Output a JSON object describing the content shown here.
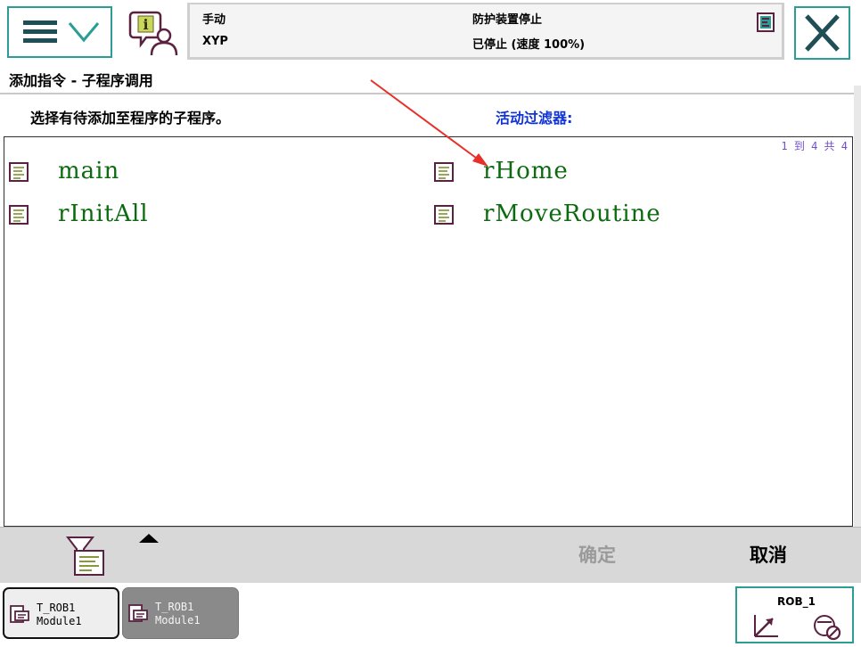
{
  "header": {
    "mode": "手动",
    "system_name": "XYP",
    "safety_state": "防护装置停止",
    "run_state": "已停止 (速度 100%)"
  },
  "page": {
    "title": "添加指令 - 子程序调用",
    "instruction": "选择有待添加至程序的子程序。",
    "filter_label": "活动过滤器:",
    "pager": "1 到 4 共 4"
  },
  "routines": [
    {
      "name": "main",
      "icon": "routine-icon"
    },
    {
      "name": "rHome",
      "icon": "routine-icon"
    },
    {
      "name": "rInitAll",
      "icon": "routine-icon"
    },
    {
      "name": "rMoveRoutine",
      "icon": "routine-icon"
    }
  ],
  "toolbar": {
    "ok_label": "确定",
    "cancel_label": "取消"
  },
  "taskbar": {
    "tasks": [
      {
        "task": "T_ROB1",
        "module": "Module1",
        "active": true
      },
      {
        "task": "T_ROB1",
        "module": "Module1",
        "active": false
      }
    ],
    "jog_unit": "ROB_1"
  },
  "colors": {
    "accent": "#2a9d94",
    "routine_text": "#0c6b10",
    "filter_text": "#1033d9",
    "disabled_text": "#9a9a9a",
    "annotation_arrow": "#e8302a"
  }
}
